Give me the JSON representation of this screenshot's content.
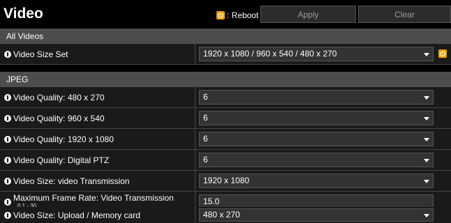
{
  "header": {
    "title": "Video",
    "reboot_label": ": Reboot",
    "apply_label": "Apply",
    "clear_label": "Clear"
  },
  "sections": {
    "all_videos": "All Videos",
    "jpeg": "JPEG"
  },
  "rows": [
    {
      "label": "Video Size Set",
      "value": "1920 x 1080 / 960 x 540 / 480 x 270",
      "type": "select",
      "reboot": true
    },
    {
      "label": "Video Quality: 480 x 270",
      "value": "6",
      "type": "select"
    },
    {
      "label": "Video Quality: 960 x 540",
      "value": "6",
      "type": "select"
    },
    {
      "label": "Video Quality: 1920 x 1080",
      "value": "6",
      "type": "select"
    },
    {
      "label": "Video Quality: Digital PTZ",
      "value": "6",
      "type": "select"
    },
    {
      "label": "Video Size: video Transmission",
      "value": "1920 x 1080",
      "type": "select"
    },
    {
      "label": "Maximum Frame Rate: Video Transmission",
      "sublabel": "0.1 - 30",
      "value": "15.0",
      "type": "input"
    },
    {
      "label": "Video Size: Upload / Memory card",
      "value": "480 x 270",
      "type": "select"
    }
  ],
  "colors": {
    "reboot_icon": "#f0a000",
    "section_bg": "#4d4d4d",
    "row_bg": "#1a1a1a"
  },
  "icons": [
    "reboot-icon",
    "info-icon",
    "chevron-down-icon"
  ]
}
